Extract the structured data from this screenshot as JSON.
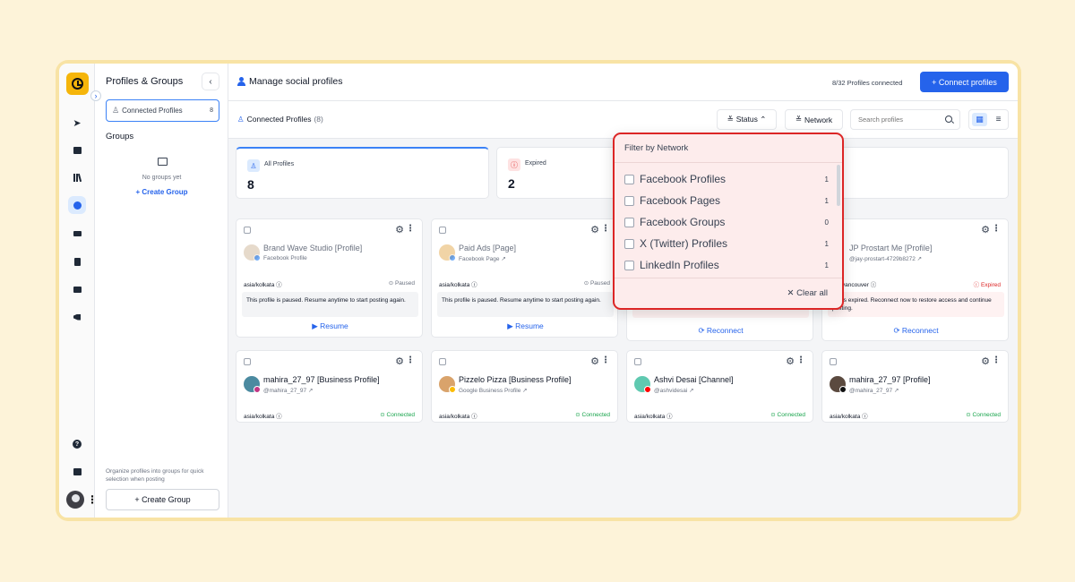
{
  "sidebar": {
    "title": "Profiles & Groups",
    "collapse_icon": "‹",
    "profile_filter": {
      "label": "Connected Profiles",
      "count": "8"
    },
    "groups_label": "Groups",
    "empty_text": "No groups yet",
    "create_link": "+ Create Group",
    "note": "Organize profiles into groups for quick selection when posting",
    "create_button": "+ Create Group"
  },
  "header": {
    "title": "Manage social profiles",
    "connected_count": "8/32 Profiles connected",
    "connect_button": "+ Connect profiles"
  },
  "toolbar": {
    "title": "Connected Profiles",
    "count": "(8)",
    "status_label": "Status ⌃",
    "network_label": "Network",
    "search_placeholder": "Search profiles"
  },
  "stats": [
    {
      "label": "All Profiles",
      "value": "8"
    },
    {
      "label": "Expired",
      "value": "2"
    }
  ],
  "cards": [
    {
      "name": "Brand Wave Studio [Profile]",
      "sub": "Facebook Profile",
      "tz": "asia/kolkata ⓘ",
      "state": "⊙ Paused",
      "note": "This profile is paused. Resume anytime to start posting again.",
      "action": "▶  Resume"
    },
    {
      "name": "Paid Ads [Page]",
      "sub": "Facebook Page ↗",
      "tz": "asia/kolkata ⓘ",
      "state": "⊙ Paused",
      "note": "This profile is paused. Resume anytime to start posting again.",
      "action": "▶  Resume"
    },
    {
      "note": "continue posting.",
      "action": "⟳  Reconnect"
    },
    {
      "name": "JP Prostart Me [Profile]",
      "sub": "@jay-prostart-4729b8272 ↗",
      "tz": "erica/vancouver ⓘ",
      "state": "ⓘ Expired",
      "note": "n has expired. Reconnect now to restore access and continue posting.",
      "action": "⟳  Reconnect"
    },
    {
      "name": "mahira_27_97 [Business Profile]",
      "sub": "@mahira_27_97 ↗",
      "tz": "asia/kolkata ⓘ",
      "state": "⊙ Connected"
    },
    {
      "name": "Pizzelo Pizza [Business Profile]",
      "sub": "Google Business Profile ↗",
      "tz": "asia/kolkata ⓘ",
      "state": "⊙ Connected"
    },
    {
      "name": "Ashvi Desai [Channel]",
      "sub": "@ashvidesai ↗",
      "tz": "asia/kolkata ⓘ",
      "state": "⊙ Connected"
    },
    {
      "name": "mahira_27_97 [Profile]",
      "sub": "@mahira_27_97 ↗",
      "tz": "asia/kolkata ⓘ",
      "state": "⊙ Connected"
    }
  ],
  "network_filter": {
    "title": "Filter by Network",
    "options": [
      {
        "label": "Facebook Profiles",
        "count": "1"
      },
      {
        "label": "Facebook Pages",
        "count": "1"
      },
      {
        "label": "Facebook Groups",
        "count": "0"
      },
      {
        "label": "X (Twitter) Profiles",
        "count": "1"
      },
      {
        "label": "LinkedIn Profiles",
        "count": "1"
      }
    ],
    "clear_label": "✕  Clear all"
  },
  "colors": {
    "accent": "#2563eb",
    "brand": "#f5b50a",
    "danger": "#dc2626",
    "success": "#16a34a"
  }
}
